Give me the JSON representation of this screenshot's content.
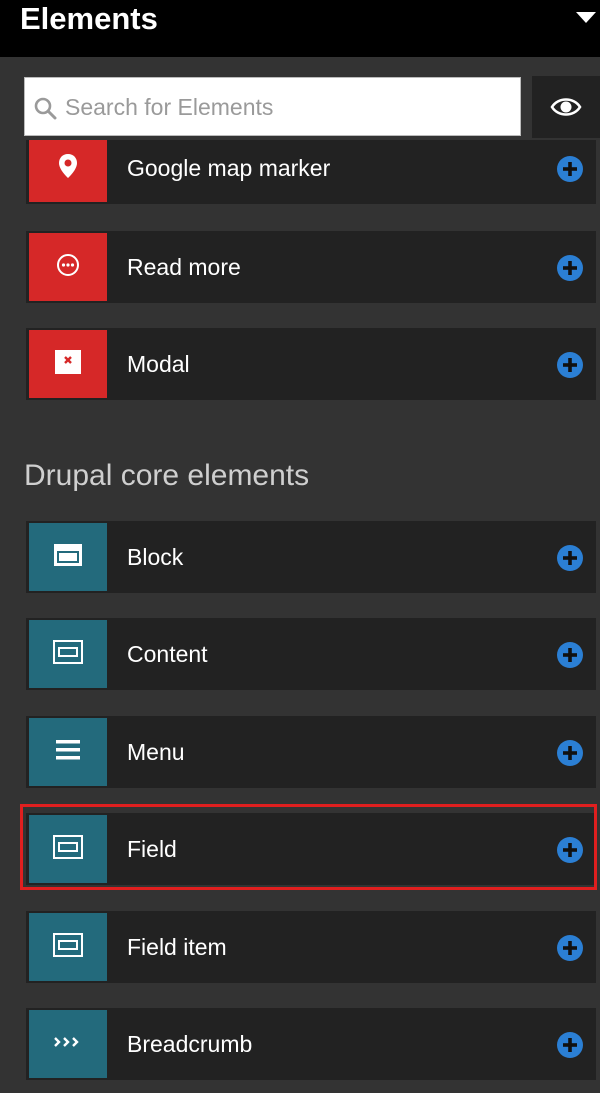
{
  "panel": {
    "title": "Elements",
    "search_placeholder": "Search for Elements",
    "section_heading": "Drupal core elements"
  },
  "items": [
    {
      "label": "Google map marker",
      "icon": "map-marker-icon",
      "color": "#d62828"
    },
    {
      "label": "Read more",
      "icon": "ellipsis-circle-icon",
      "color": "#d62828"
    },
    {
      "label": "Modal",
      "icon": "modal-close-icon",
      "color": "#d62828"
    },
    {
      "label": "Block",
      "icon": "block-icon",
      "color": "#236a7c"
    },
    {
      "label": "Content",
      "icon": "content-icon",
      "color": "#236a7c"
    },
    {
      "label": "Menu",
      "icon": "hamburger-menu-icon",
      "color": "#236a7c"
    },
    {
      "label": "Field",
      "icon": "field-icon",
      "color": "#236a7c",
      "highlighted": true
    },
    {
      "label": "Field item",
      "icon": "field-item-icon",
      "color": "#236a7c"
    },
    {
      "label": "Breadcrumb",
      "icon": "breadcrumb-icon",
      "color": "#236a7c"
    }
  ],
  "colors": {
    "add_button": "#2b7fd4",
    "highlight": "#e01f1f"
  }
}
